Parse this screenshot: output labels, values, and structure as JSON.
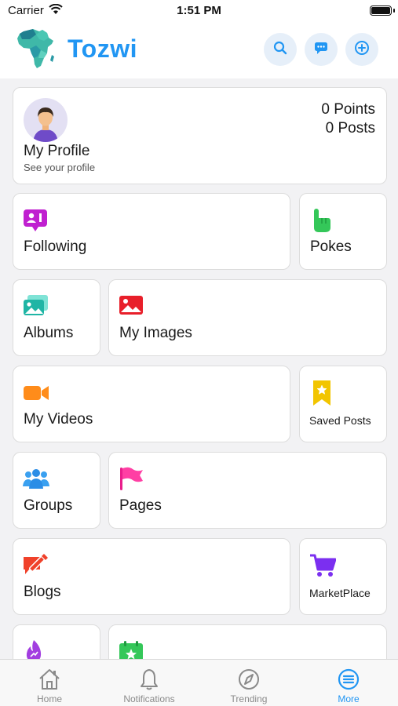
{
  "status_bar": {
    "carrier": "Carrier",
    "time": "1:51 PM"
  },
  "header": {
    "title": "Tozwi",
    "actions": [
      "search-icon",
      "chat-icon",
      "add-icon"
    ]
  },
  "profile": {
    "name": "My Profile",
    "subtitle": "See your profile",
    "points": "0 Points",
    "posts": "0 Posts"
  },
  "menu": {
    "following": "Following",
    "pokes": "Pokes",
    "albums": "Albums",
    "my_images": "My Images",
    "my_videos": "My Videos",
    "saved_posts": "Saved Posts",
    "groups": "Groups",
    "pages": "Pages",
    "blogs": "Blogs",
    "marketplace": "MarketPlace"
  },
  "tabs": [
    {
      "label": "Home",
      "icon": "home-icon",
      "active": false
    },
    {
      "label": "Notifications",
      "icon": "bell-icon",
      "active": false
    },
    {
      "label": "Trending",
      "icon": "compass-icon",
      "active": false
    },
    {
      "label": "More",
      "icon": "menu-icon",
      "active": true
    }
  ],
  "colors": {
    "brand": "#2196f3",
    "accent_bg": "#e6eff9",
    "active_tab": "#2196f3"
  }
}
